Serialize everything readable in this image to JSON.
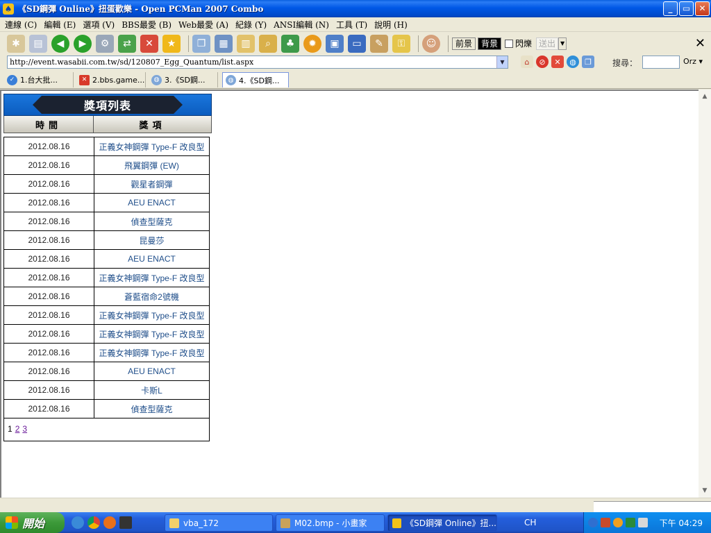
{
  "window": {
    "title": "《SD鋼彈 Online》扭蛋歡樂 - Open PCMan 2007 Combo",
    "controls": [
      "_",
      "▭",
      "✕"
    ]
  },
  "menu": [
    "連線 (C)",
    "編輯 (E)",
    "選項 (V)",
    "BBS最愛 (B)",
    "Web最愛 (A)",
    "紀錄 (Y)",
    "ANSI編輯 (N)",
    "工具 (T)",
    "說明 (H)"
  ],
  "toolbar": {
    "fg_label": "前景",
    "bg_label": "背景",
    "blink_label": "閃爍",
    "send_label": "送出"
  },
  "address": {
    "url": "http://event.wasabii.com.tw/sd/120807_Egg_Quantum/list.aspx",
    "search_label": "搜尋：",
    "search_engine": "Orz"
  },
  "tabs": [
    {
      "label": "1.台大批..."
    },
    {
      "label": "2.bbs.game..."
    },
    {
      "label": "3.《SD鋼..."
    },
    {
      "label": "4.《SD鋼..."
    }
  ],
  "prize_list": {
    "title": "獎項列表",
    "col_time": "時間",
    "col_prize": "獎項",
    "rows": [
      {
        "date": "2012.08.16",
        "prize": "正義女神鋼彈 Type-F 改良型"
      },
      {
        "date": "2012.08.16",
        "prize": "飛翼鋼彈 (EW)"
      },
      {
        "date": "2012.08.16",
        "prize": "觀星者鋼彈"
      },
      {
        "date": "2012.08.16",
        "prize": "AEU ENACT"
      },
      {
        "date": "2012.08.16",
        "prize": "偵查型薩克"
      },
      {
        "date": "2012.08.16",
        "prize": "昆曼莎"
      },
      {
        "date": "2012.08.16",
        "prize": "AEU ENACT"
      },
      {
        "date": "2012.08.16",
        "prize": "正義女神鋼彈 Type-F 改良型"
      },
      {
        "date": "2012.08.16",
        "prize": "蒼藍宿命2號機"
      },
      {
        "date": "2012.08.16",
        "prize": "正義女神鋼彈 Type-F 改良型"
      },
      {
        "date": "2012.08.16",
        "prize": "正義女神鋼彈 Type-F 改良型"
      },
      {
        "date": "2012.08.16",
        "prize": "正義女神鋼彈 Type-F 改良型"
      },
      {
        "date": "2012.08.16",
        "prize": "AEU ENACT"
      },
      {
        "date": "2012.08.16",
        "prize": "卡斯L"
      },
      {
        "date": "2012.08.16",
        "prize": "偵查型薩克"
      }
    ],
    "pages": [
      "1",
      "2",
      "3"
    ]
  },
  "taskbar": {
    "start_label": "開始",
    "tasks": [
      {
        "label": "vba_172"
      },
      {
        "label": "M02.bmp - 小畫家"
      },
      {
        "label": "《SD鋼彈 Online》扭..."
      }
    ],
    "lang": "CH",
    "clock": "下午 04:29"
  }
}
